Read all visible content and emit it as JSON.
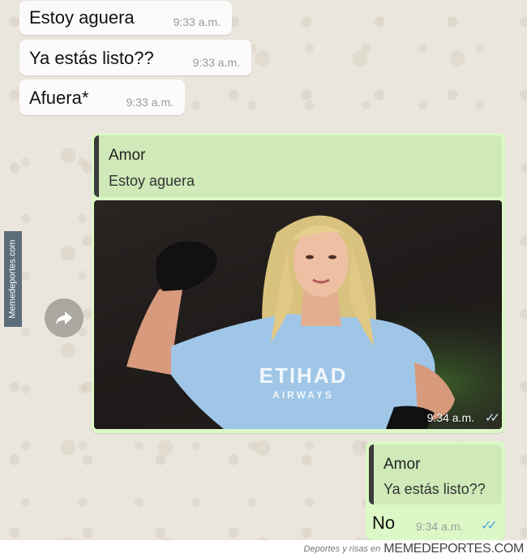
{
  "incoming": [
    {
      "text": "Estoy aguera",
      "time": "9:33 a.m."
    },
    {
      "text": "Ya estás listo??",
      "time": "9:33 a.m."
    },
    {
      "text": "Afuera*",
      "time": "9:33 a.m."
    }
  ],
  "photo_message": {
    "quote_author": "Amor",
    "quote_text": "Estoy aguera",
    "time": "9:34 a.m.",
    "jersey_text": "ETIHAD",
    "jersey_subtext": "AIRWAYS"
  },
  "last_message": {
    "quote_author": "Amor",
    "quote_text": "Ya estás listo??",
    "text": "No",
    "time": "9:34 a.m."
  },
  "watermark": {
    "side": "Memedeportes.com",
    "footer_small": "Deportes y risas en",
    "footer_brand": "MEMEDEPORTES.COM"
  },
  "icons": {
    "forward": "forward-arrow-icon",
    "read_receipt": "double-check-icon"
  },
  "colors": {
    "incoming_bubble": "#fbfbfb",
    "outgoing_bubble": "#dcf8c6",
    "quote_bar": "#3a3a3a",
    "read_ticks": "#4fa8e8"
  }
}
